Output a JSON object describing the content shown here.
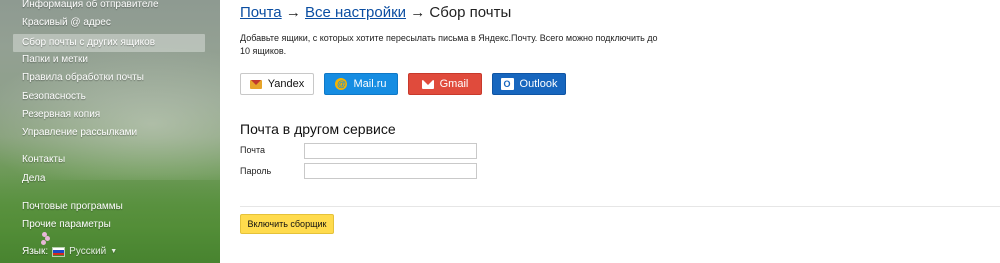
{
  "sidebar": {
    "items": [
      {
        "label": "Информация об отправителе",
        "active": false
      },
      {
        "label": "Красивый @ адрес",
        "active": false
      },
      {
        "label": "Сбор почты с других ящиков",
        "active": true
      },
      {
        "label": "Папки и метки",
        "active": false
      },
      {
        "label": "Правила обработки почты",
        "active": false
      },
      {
        "label": "Безопасность",
        "active": false
      },
      {
        "label": "Резервная копия",
        "active": false
      },
      {
        "label": "Управление рассылками",
        "active": false
      },
      {
        "label": "Контакты",
        "active": false
      },
      {
        "label": "Дела",
        "active": false
      },
      {
        "label": "Почтовые программы",
        "active": false
      },
      {
        "label": "Прочие параметры",
        "active": false
      }
    ],
    "language": {
      "label": "Язык:",
      "value": "Русский"
    }
  },
  "breadcrumb": {
    "items": [
      "Почта",
      "Все настройки"
    ],
    "separator": "→",
    "current": "Сбор почты"
  },
  "description": "Добавьте ящики, с которых хотите пересылать письма в Яндекс.Почту. Всего можно подключить до 10 ящиков.",
  "providers": [
    {
      "label": "Yandex",
      "icon": "yandex-envelope-icon",
      "color": "#ffffff"
    },
    {
      "label": "Mail.ru",
      "icon": "mailru-at-icon",
      "color": "#168de2"
    },
    {
      "label": "Gmail",
      "icon": "gmail-envelope-icon",
      "color": "#e04b3c"
    },
    {
      "label": "Outlook",
      "icon": "outlook-icon",
      "color": "#1766be"
    }
  ],
  "form": {
    "title": "Почта в другом сервисе",
    "email_label": "Почта",
    "email_value": "",
    "password_label": "Пароль",
    "password_value": "",
    "submit_label": "Включить сборщик"
  },
  "colors": {
    "link": "#0b4ea2",
    "submit_bg": "#ffdb4d"
  }
}
